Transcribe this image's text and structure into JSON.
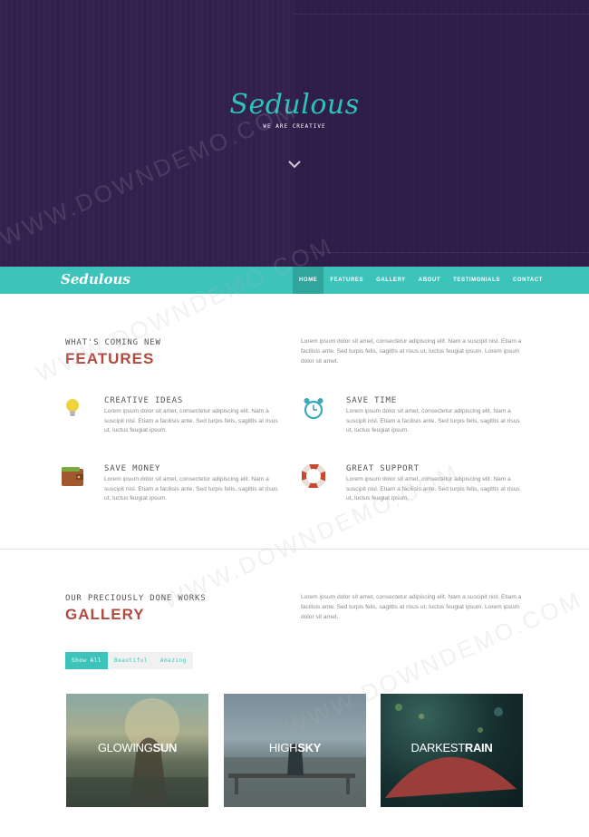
{
  "hero": {
    "logo": "Sedulous",
    "tagline": "WE ARE CREATIVE",
    "scroll_icon": "chevron-down-icon",
    "background": "#33204d",
    "accent": "#2cc3b8"
  },
  "nav": {
    "logo": "Sedulous",
    "background": "#3ec3ba",
    "items": [
      {
        "label": "HOME",
        "active": true
      },
      {
        "label": "FEATURES",
        "active": false
      },
      {
        "label": "GALLERY",
        "active": false
      },
      {
        "label": "ABOUT",
        "active": false
      },
      {
        "label": "TESTIMONIALS",
        "active": false
      },
      {
        "label": "CONTACT",
        "active": false
      }
    ]
  },
  "features": {
    "kicker": "WHAT'S COMING NEW",
    "heading": "FEATURES",
    "intro": "Lorem ipsum dolor sit amet, consectetur adipiscing elit. Nam a suscipit nisl. Etiam a facilisis ante. Sed turpis felis, sagittis at risus ut, luctus feugiat ipsum. Lorem ipsum dolor sit amet.",
    "items": [
      {
        "icon": "lightbulb-icon",
        "title": "CREATIVE IDEAS",
        "text": "Lorem ipsum dolor sit amet, consectetur adipiscing elit. Nam a suscipit nisl. Etiam a facilisis ante. Sed turpis felis, sagittis at risus ut, luctus feugiat ipsum."
      },
      {
        "icon": "alarm-clock-icon",
        "title": "SAVE TIME",
        "text": "Lorem ipsum dolor sit amet, consectetur adipiscing elit. Nam a suscipit nisl. Etiam a facilisis ante. Sed turpis felis, sagittis at risus ut, luctus feugiat ipsum."
      },
      {
        "icon": "wallet-icon",
        "title": "SAVE MONEY",
        "text": "Lorem ipsum dolor sit amet, consectetur adipiscing elit. Nam a suscipit nisl. Etiam a facilisis ante. Sed turpis felis, sagittis at risus ut, luctus feugiat ipsum."
      },
      {
        "icon": "lifebuoy-icon",
        "title": "GREAT SUPPORT",
        "text": "Lorem ipsum dolor sit amet, consectetur adipiscing elit. Nam a suscipit nisl. Etiam a facilisis ante. Sed turpis felis, sagittis at risus ut, luctus feugiat ipsum."
      }
    ]
  },
  "gallery": {
    "kicker": "OUR PRECIOUSLY DONE WORKS",
    "heading": "GALLERY",
    "intro": "Lorem ipsum dolor sit amet, consectetur adipiscing elit. Nam a suscipit nisl. Etiam a facilisis ante. Sed turpis felis, sagittis at risus ut, luctus feugiat ipsum. Lorem ipsum dolor sit amet.",
    "filters": [
      {
        "label": "Show All",
        "active": true
      },
      {
        "label": "Beautiful",
        "active": false
      },
      {
        "label": "Amazing",
        "active": false
      }
    ],
    "items": [
      {
        "light": "GLOWING",
        "bold": "SUN"
      },
      {
        "light": "HIGH",
        "bold": "SKY"
      },
      {
        "light": "DARKEST",
        "bold": "RAIN"
      }
    ]
  },
  "watermark": "WWW.DOWNDEMO.COM"
}
